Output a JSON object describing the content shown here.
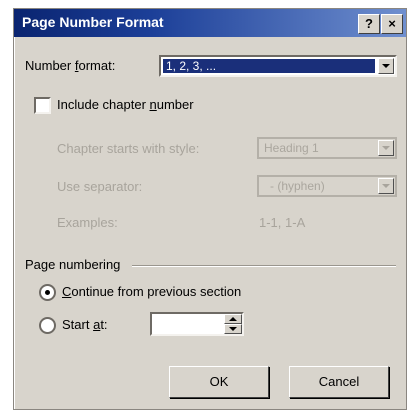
{
  "dialog": {
    "title": "Page Number Format",
    "help_label": "?",
    "close_label": "×"
  },
  "number_format": {
    "label_pre": "Number ",
    "label_key": "f",
    "label_post": "ormat:",
    "value": "1, 2, 3, ..."
  },
  "include_chapter": {
    "label_pre": "Include chapter ",
    "label_key": "n",
    "label_post": "umber",
    "checked": false
  },
  "chapter_style": {
    "label": "Chapter starts with style:",
    "value": "Heading 1"
  },
  "separator": {
    "label": "Use separator:",
    "value": "- (hyphen)"
  },
  "examples": {
    "label": "Examples:",
    "value": "1-1, 1-A"
  },
  "page_numbering": {
    "label": "Page numbering",
    "continue_pre": "",
    "continue_key": "C",
    "continue_post": "ontinue from previous section",
    "start_pre": "Start ",
    "start_key": "a",
    "start_post": "t:",
    "start_value": "",
    "selected": "continue"
  },
  "buttons": {
    "ok": "OK",
    "cancel": "Cancel"
  },
  "colors": {
    "title_bar": "#0a2470",
    "selection": "#1a2f7a",
    "dialog_face": "#d8d4cc"
  }
}
